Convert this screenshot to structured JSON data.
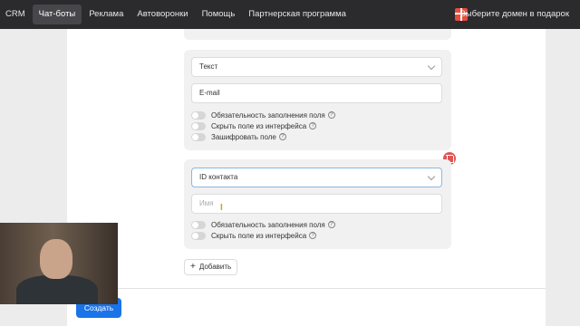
{
  "topnav": {
    "items": [
      {
        "label": "CRM",
        "active": false
      },
      {
        "label": "Чат-боты",
        "active": true
      },
      {
        "label": "Реклама",
        "active": false
      },
      {
        "label": "Автоворонки",
        "active": false
      },
      {
        "label": "Помощь",
        "active": false
      },
      {
        "label": "Партнерская программа",
        "active": false
      }
    ],
    "domain_label": "Выберите домен в подарок",
    "gift_icon": "gift-icon"
  },
  "fields": [
    {
      "type_value": "Текст",
      "name_value": "E-mail",
      "toggles": [
        {
          "label": "Обязательность заполнения поля",
          "on": false,
          "help": true
        },
        {
          "label": "Скрыть поле из интерфейса",
          "on": false,
          "help": true
        },
        {
          "label": "Зашифровать поле",
          "on": false,
          "help": true
        }
      ]
    },
    {
      "type_value": "ID контакта",
      "name_placeholder": "Имя",
      "toggles": [
        {
          "label": "Обязательность заполнения поля",
          "on": false,
          "help": true
        },
        {
          "label": "Скрыть поле из интерфейса",
          "on": false,
          "help": true
        }
      ]
    }
  ],
  "help_glyph": "?",
  "add_button": {
    "plus": "+",
    "label": "Добавить"
  },
  "create_button": {
    "label": "Создать"
  },
  "colors": {
    "topbar": "#2b2b2e",
    "primary": "#1a73e8",
    "delete": "#e05555",
    "card": "#f1f1f1"
  }
}
